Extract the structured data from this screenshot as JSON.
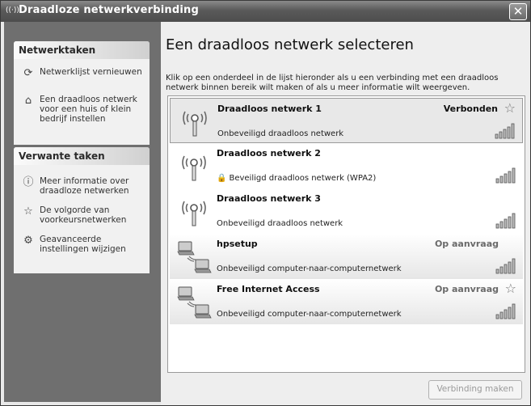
{
  "window": {
    "title": "Draadloze netwerkverbinding",
    "close_label": "✕"
  },
  "sidebar": {
    "panels": [
      {
        "header": "Netwerktaken",
        "items": [
          {
            "icon": "refresh-icon",
            "label": "Netwerklijst vernieuwen"
          },
          {
            "icon": "home-network-icon",
            "label": "Een draadloos netwerk voor een huis of klein bedrijf instellen"
          }
        ]
      },
      {
        "header": "Verwante taken",
        "items": [
          {
            "icon": "info-icon",
            "label": "Meer informatie over draadloze netwerken"
          },
          {
            "icon": "star-icon",
            "label": "De volgorde van voorkeursnetwerken"
          },
          {
            "icon": "settings-icon",
            "label": "Geavanceerde instellingen wijzigen"
          }
        ]
      }
    ]
  },
  "main": {
    "heading": "Een draadloos netwerk selecteren",
    "description": "Klik op een onderdeel in de lijst hieronder als u een verbinding met een draadloos netwerk binnen bereik wilt maken of als u meer informatie wilt weergeven.",
    "networks": [
      {
        "name": "Draadloos netwerk 1",
        "status": "Verbonden",
        "starred": true,
        "security": "Onbeveiligd draadloos netwerk",
        "locked": false,
        "type": "access-point",
        "signal_bars": 5
      },
      {
        "name": "Draadloos netwerk 2",
        "status": "",
        "starred": false,
        "security": "Beveiligd draadloos netwerk (WPA2)",
        "locked": true,
        "type": "access-point",
        "signal_bars": 5
      },
      {
        "name": "Draadloos netwerk 3",
        "status": "",
        "starred": false,
        "security": "Onbeveiligd draadloos netwerk",
        "locked": false,
        "type": "access-point",
        "signal_bars": 5
      },
      {
        "name": "hpsetup",
        "status": "Op aanvraag",
        "starred": false,
        "security": "Onbeveiligd computer-naar-computernetwerk",
        "locked": false,
        "type": "ad-hoc",
        "signal_bars": 5
      },
      {
        "name": "Free Internet Access",
        "status": "Op aanvraag",
        "starred": true,
        "security": "Onbeveiligd computer-naar-computernetwerk",
        "locked": false,
        "type": "ad-hoc",
        "signal_bars": 5
      }
    ],
    "connect_label": "Verbinding maken"
  }
}
